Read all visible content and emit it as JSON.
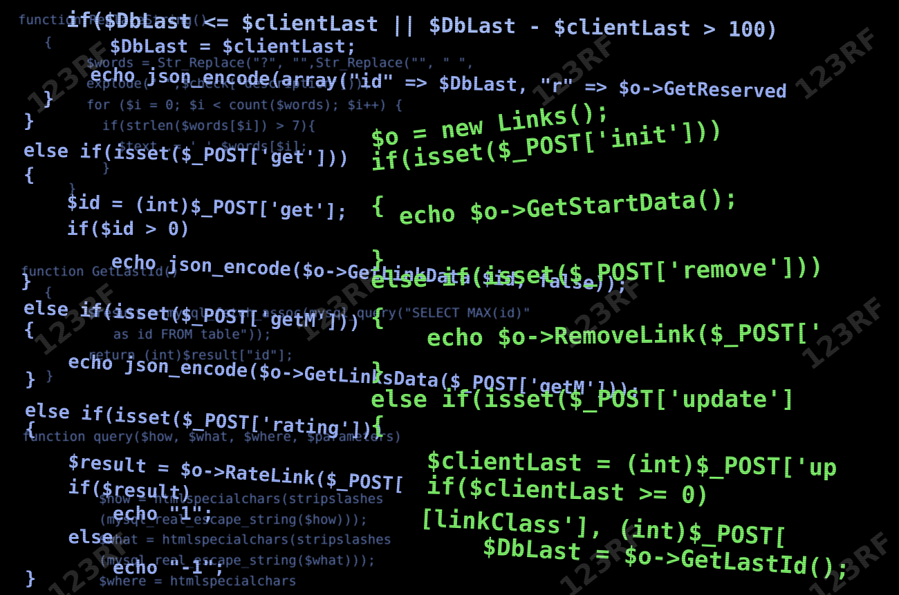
{
  "photo": {
    "watermark": "123RF",
    "far_lines": [
      "function ReplaceString()",
      "{",
      "  $words = Str_Replace(\"?\", \"\",Str_Replace(\"\", \" \",",
      "  explode(\" \",$check['description']));",
      "  for ($i = 0; $i < count($words); $i++) {",
      "    if(strlen($words[$i]) > 7){",
      "      $text .= ' '.$words[$i];",
      "    }",
      "  }",
      "function GetLastId()",
      "{",
      "  $result = mysql_fetch_assoc(mysql_query(\"SELECT MAX(id)\"",
      "    as id FROM table\"));",
      "  return (int)$result[\"id\"];",
      "}",
      "function query($how, $what, $where, $parameters)",
      "  $how = htmlspecialchars(stripslashes",
      "  (mysql_real_escape_string($how)));",
      "  $what = htmlspecialchars(stripslashes",
      "  (mysql_real_escape_string($what)));",
      "  $where = htmlspecialchars"
    ],
    "mid_lines": [
      "  $DbLast = $clientLast;",
      "  echo json_encode(array(\"id\" => $DbLast, \"r\" => $o->GetReserved",
      "}",
      "}",
      "else if(isset($_POST['get']))",
      "{",
      "  $id = (int)$_POST['get'];",
      "  if($id > 0)",
      "    echo json_encode($o->GetLinkData($id, false));",
      "}",
      "else if(isset($_POST['getM']))",
      "{",
      "  echo json_encode($o->GetLinksData($_POST['getM']));",
      "}",
      "else if(isset($_POST['rating']))",
      "{",
      "  $result = $o->RateLink($_POST[",
      "  if($result)",
      "    echo \"1\";",
      "  else",
      "    echo \"-1\";",
      "}"
    ],
    "top_line": "if($DbLast <= $clientLast || $DbLast - $clientLast > 100)",
    "near_lines": [
      "$o = new Links();",
      "if(isset($_POST['init']))",
      "{",
      "  echo $o->GetStartData();",
      "}",
      "else if(isset($_POST['remove']))",
      "{",
      "  echo $o->RemoveLink($_POST['",
      "}",
      "else if(isset($_POST['update']",
      "{",
      "  $clientLast = (int)$_POST['up",
      "  if($clientLast >= 0)",
      "  [linkClass'], (int)$_POST[",
      "    $DbLast = $o->GetLastId();"
    ]
  }
}
